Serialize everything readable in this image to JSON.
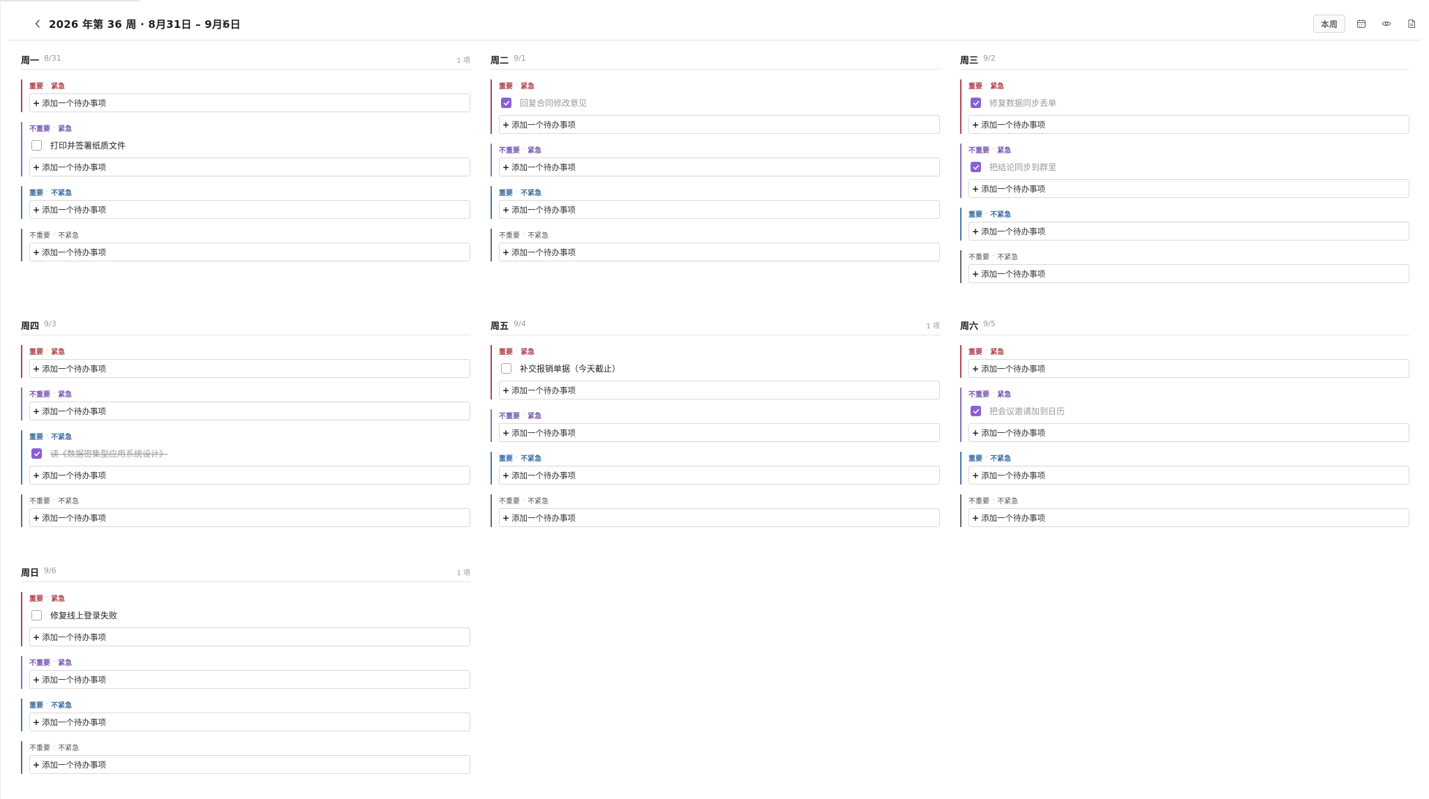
{
  "header": {
    "week_title": "2026 年第 36 周 · 8月31日 – 9月6日",
    "this_week_label": "本周"
  },
  "colors": {
    "important_urgent": "#b0464f",
    "not_important_urgent": "#8a6fb3",
    "important_not_urgent": "#4a78a8",
    "not_important_not_urgent": "#6a6a6a",
    "checkbox_checked": "#8b5fd6"
  },
  "labels": {
    "important": "重要",
    "not_important": "不重要",
    "urgent": "紧急",
    "not_urgent": "不紧急",
    "separator": "·",
    "add_todo": "添加一个待办事项",
    "plus": "+"
  },
  "days": [
    {
      "name": "周一",
      "date": "8/31",
      "count": "1 项",
      "quadrants": [
        {
          "tasks": []
        },
        {
          "tasks": [
            {
              "text": "打印并签署纸质文件",
              "done": false
            }
          ]
        },
        {
          "tasks": []
        },
        {
          "tasks": []
        }
      ]
    },
    {
      "name": "周二",
      "date": "9/1",
      "count": "",
      "quadrants": [
        {
          "tasks": [
            {
              "text": "回复合同修改意见",
              "done": true
            }
          ]
        },
        {
          "tasks": []
        },
        {
          "tasks": []
        },
        {
          "tasks": []
        }
      ]
    },
    {
      "name": "周三",
      "date": "9/2",
      "count": "",
      "quadrants": [
        {
          "tasks": [
            {
              "text": "修复数据同步丢单",
              "done": true
            }
          ]
        },
        {
          "tasks": [
            {
              "text": "把结论同步到群里",
              "done": true
            }
          ]
        },
        {
          "tasks": []
        },
        {
          "tasks": []
        }
      ]
    },
    {
      "name": "周四",
      "date": "9/3",
      "count": "",
      "quadrants": [
        {
          "tasks": []
        },
        {
          "tasks": []
        },
        {
          "tasks": [
            {
              "text": "读《数据密集型应用系统设计》",
              "done": true,
              "strike": true
            }
          ]
        },
        {
          "tasks": []
        }
      ]
    },
    {
      "name": "周五",
      "date": "9/4",
      "count": "1 项",
      "quadrants": [
        {
          "tasks": [
            {
              "text": "补交报销单据（今天截止）",
              "done": false
            }
          ]
        },
        {
          "tasks": []
        },
        {
          "tasks": []
        },
        {
          "tasks": []
        }
      ]
    },
    {
      "name": "周六",
      "date": "9/5",
      "count": "",
      "quadrants": [
        {
          "tasks": []
        },
        {
          "tasks": [
            {
              "text": "把会议邀请加到日历",
              "done": true
            }
          ]
        },
        {
          "tasks": []
        },
        {
          "tasks": []
        }
      ]
    },
    {
      "name": "周日",
      "date": "9/6",
      "count": "1 项",
      "quadrants": [
        {
          "tasks": [
            {
              "text": "修复线上登录失败",
              "done": false
            }
          ]
        },
        {
          "tasks": []
        },
        {
          "tasks": []
        },
        {
          "tasks": []
        }
      ]
    }
  ]
}
